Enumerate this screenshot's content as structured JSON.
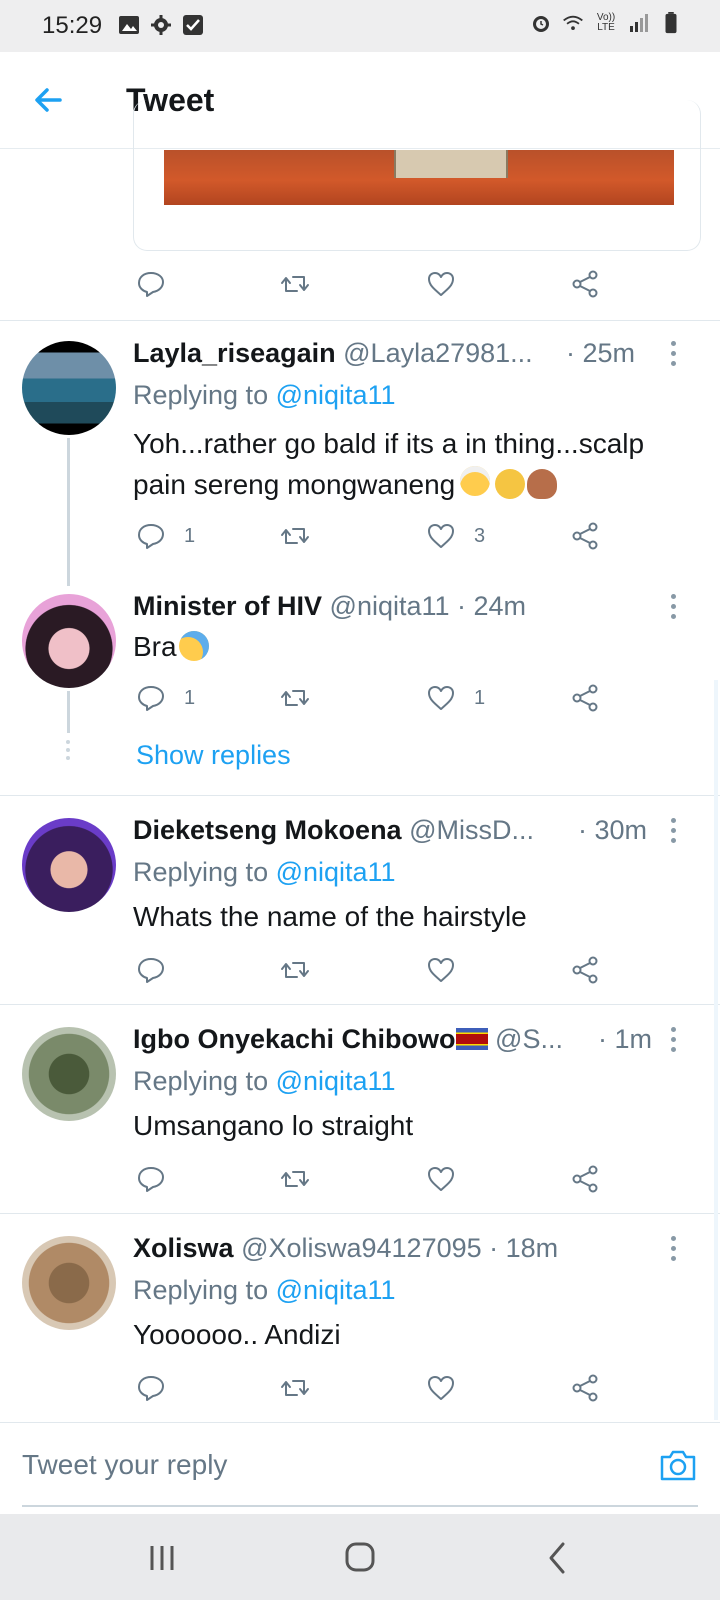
{
  "status_bar": {
    "time": "15:29",
    "network_label": "Vo)) LTE"
  },
  "header": {
    "title": "Tweet"
  },
  "top_tweet_actions": {
    "reply_count": "",
    "like_count": ""
  },
  "tweets": [
    {
      "display_name": "Layla_riseagain",
      "handle": "@Layla27981...",
      "time": "· 25m",
      "replying_prefix": "Replying to ",
      "replying_handle": "@niqita11",
      "text": "Yoh...rather go bald if its a in thing...scalp pain sereng mongwaneng",
      "reply_count": "1",
      "like_count": "3"
    },
    {
      "display_name": "Minister of HIV",
      "handle": "@niqita11 · 24m",
      "text": "Bra",
      "reply_count": "1",
      "like_count": "1",
      "show_replies": "Show replies"
    },
    {
      "display_name": "Dieketseng Mokoena",
      "handle": "@MissD...",
      "time": "· 30m",
      "replying_prefix": "Replying to ",
      "replying_handle": "@niqita11",
      "text": "Whats the name of the hairstyle",
      "reply_count": "",
      "like_count": ""
    },
    {
      "display_name": "Igbo Onyekachi Chibowo",
      "handle": "@S...",
      "time": "· 1m",
      "replying_prefix": "Replying to ",
      "replying_handle": "@niqita11",
      "text": "Umsangano lo straight",
      "reply_count": "",
      "like_count": ""
    },
    {
      "display_name": "Xoliswa",
      "handle": "@Xoliswa94127095 · 18m",
      "replying_prefix": "Replying to ",
      "replying_handle": "@niqita11",
      "text": "Yoooooo.. Andizi",
      "reply_count": "",
      "like_count": ""
    }
  ],
  "composer": {
    "placeholder": "Tweet your reply"
  },
  "colors": {
    "accent": "#1da1f2",
    "muted": "#657786"
  }
}
